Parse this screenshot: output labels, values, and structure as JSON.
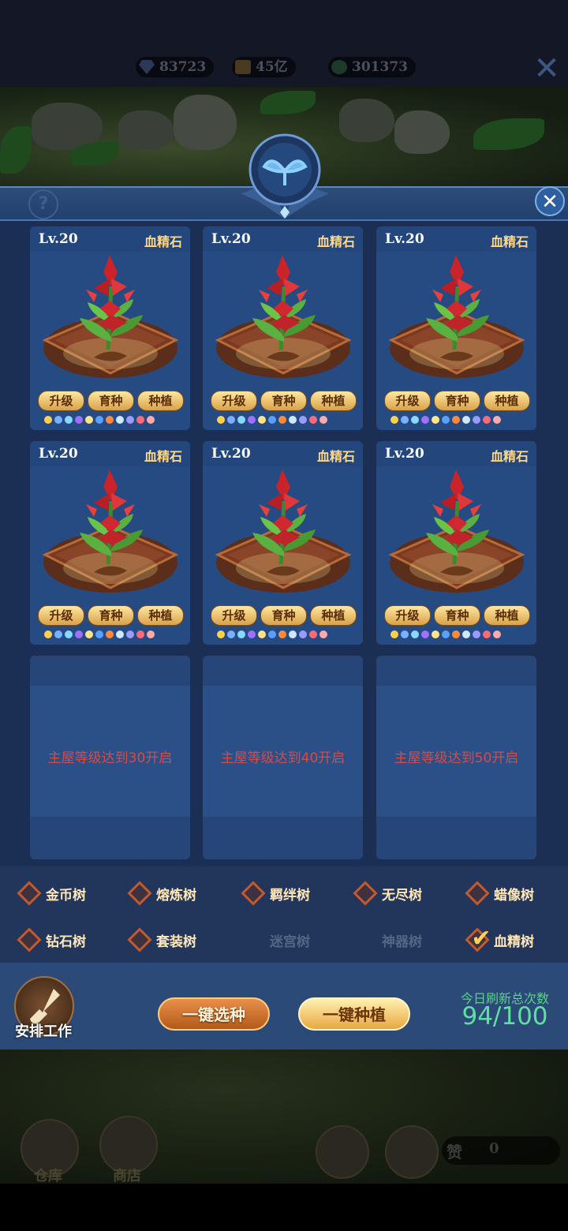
{
  "resources": {
    "gems": "83723",
    "gold": "45亿",
    "green": "301373"
  },
  "cards": [
    {
      "level": "Lv.20",
      "name": "血精石",
      "buttons": [
        "升级",
        "育种",
        "种植"
      ]
    },
    {
      "level": "Lv.20",
      "name": "血精石",
      "buttons": [
        "升级",
        "育种",
        "种植"
      ]
    },
    {
      "level": "Lv.20",
      "name": "血精石",
      "buttons": [
        "升级",
        "育种",
        "种植"
      ]
    },
    {
      "level": "Lv.20",
      "name": "血精石",
      "buttons": [
        "升级",
        "育种",
        "种植"
      ]
    },
    {
      "level": "Lv.20",
      "name": "血精石",
      "buttons": [
        "升级",
        "育种",
        "种植"
      ]
    },
    {
      "level": "Lv.20",
      "name": "血精石",
      "buttons": [
        "升级",
        "育种",
        "种植"
      ]
    }
  ],
  "locked_slots": [
    "主屋等级达到30开启",
    "主屋等级达到40开启",
    "主屋等级达到50开启"
  ],
  "tree_types": [
    {
      "label": "金币树",
      "selected": false,
      "enabled": true
    },
    {
      "label": "熔炼树",
      "selected": false,
      "enabled": true
    },
    {
      "label": "羁绊树",
      "selected": false,
      "enabled": true
    },
    {
      "label": "无尽树",
      "selected": false,
      "enabled": true
    },
    {
      "label": "蜡像树",
      "selected": false,
      "enabled": true
    },
    {
      "label": "钻石树",
      "selected": false,
      "enabled": true
    },
    {
      "label": "套装树",
      "selected": false,
      "enabled": true
    },
    {
      "label": "迷宫树",
      "selected": false,
      "enabled": false
    },
    {
      "label": "神器树",
      "selected": false,
      "enabled": false
    },
    {
      "label": "血精树",
      "selected": true,
      "enabled": true
    }
  ],
  "actions": {
    "arrange_work": "安排工作",
    "select_seed": "一键选种",
    "plant_all": "一键种植",
    "refresh_label": "今日刷新总次数",
    "refresh_count": "94/100"
  },
  "bottom": {
    "warehouse": "仓库",
    "shop": "商店",
    "like_label": "赞",
    "like_count": "0"
  },
  "colors": {
    "panel_bg": "#1b2e53",
    "card_bg": "#264a82",
    "locked_text": "#d84a45",
    "refresh_text": "#5fe0a0"
  }
}
